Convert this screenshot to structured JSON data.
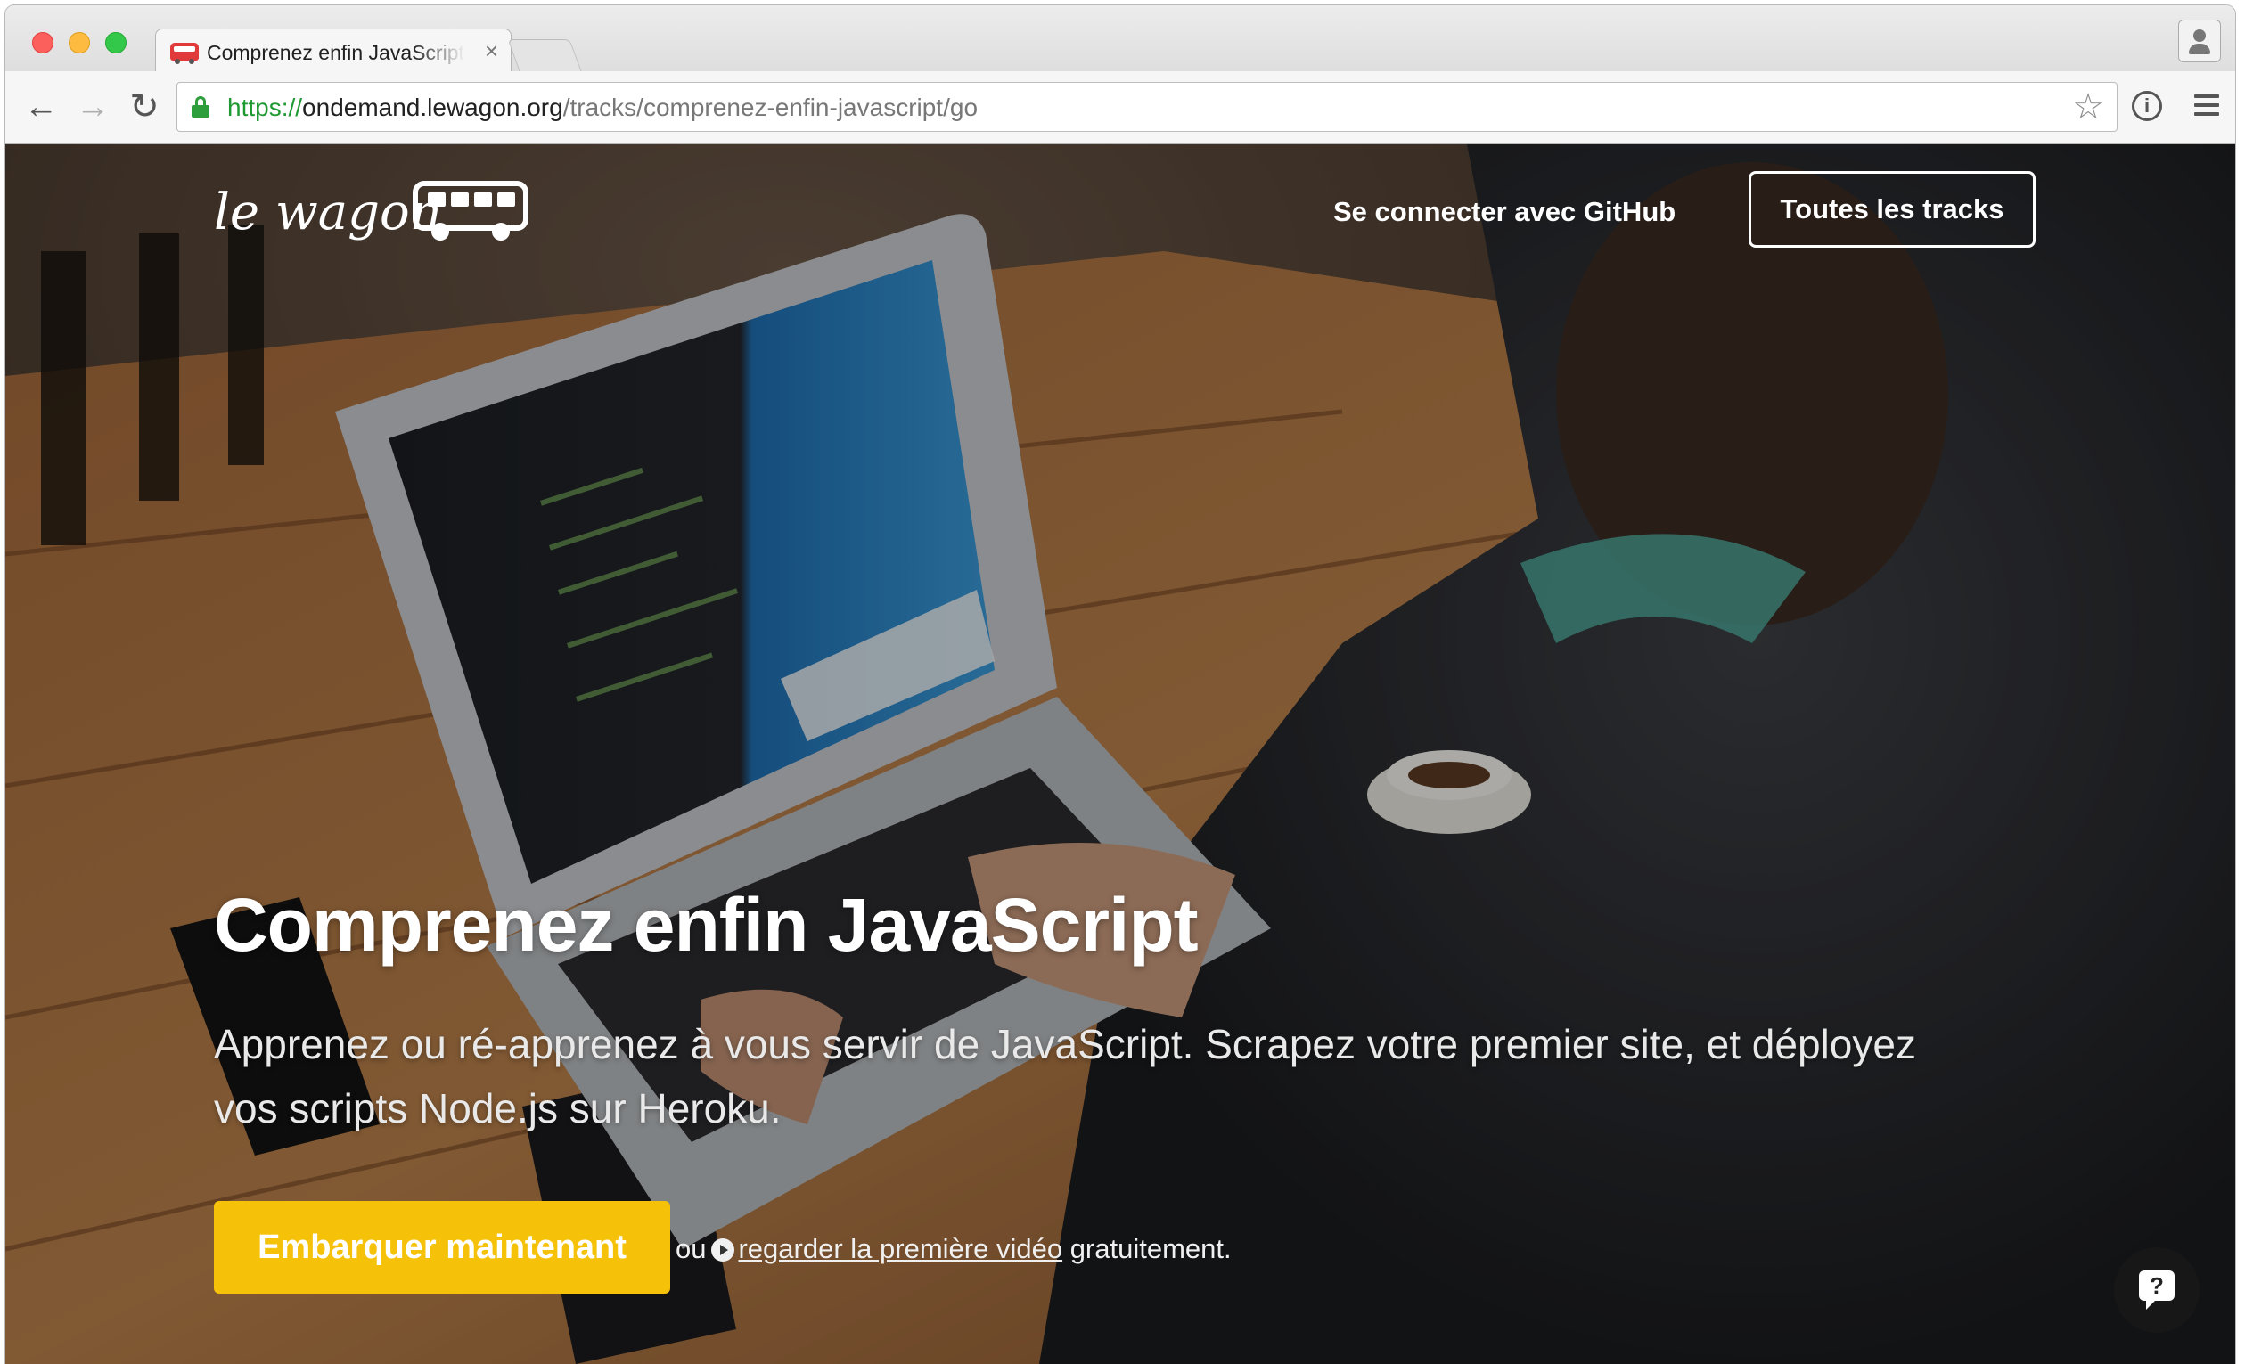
{
  "browser": {
    "tab_title": "Comprenez enfin JavaScript",
    "tab_close": "×",
    "url_scheme": "https://",
    "url_host": "ondemand.lewagon.org",
    "url_path": "/tracks/comprenez-enfin-javascript/go",
    "back_glyph": "←",
    "forward_glyph": "→",
    "reload_glyph": "↻",
    "star_glyph": "☆",
    "ext_glyph": "i"
  },
  "header": {
    "logo_text": "le wagon",
    "github_link": "Se connecter avec GitHub",
    "tracks_button": "Toutes les tracks"
  },
  "hero": {
    "title": "Comprenez enfin JavaScript",
    "subtitle": "Apprenez ou ré-apprenez à vous servir de JavaScript. Scrapez votre premier site, et déployez vos scripts Node.js sur Heroku.",
    "cta_button": "Embarquer maintenant",
    "alt_prefix": "ou",
    "alt_link": "regarder la première vidéo",
    "alt_suffix": "gratuitement."
  },
  "help": {
    "label": "?"
  },
  "colors": {
    "accent": "#f5c209",
    "secure_green": "#1f9a32"
  }
}
